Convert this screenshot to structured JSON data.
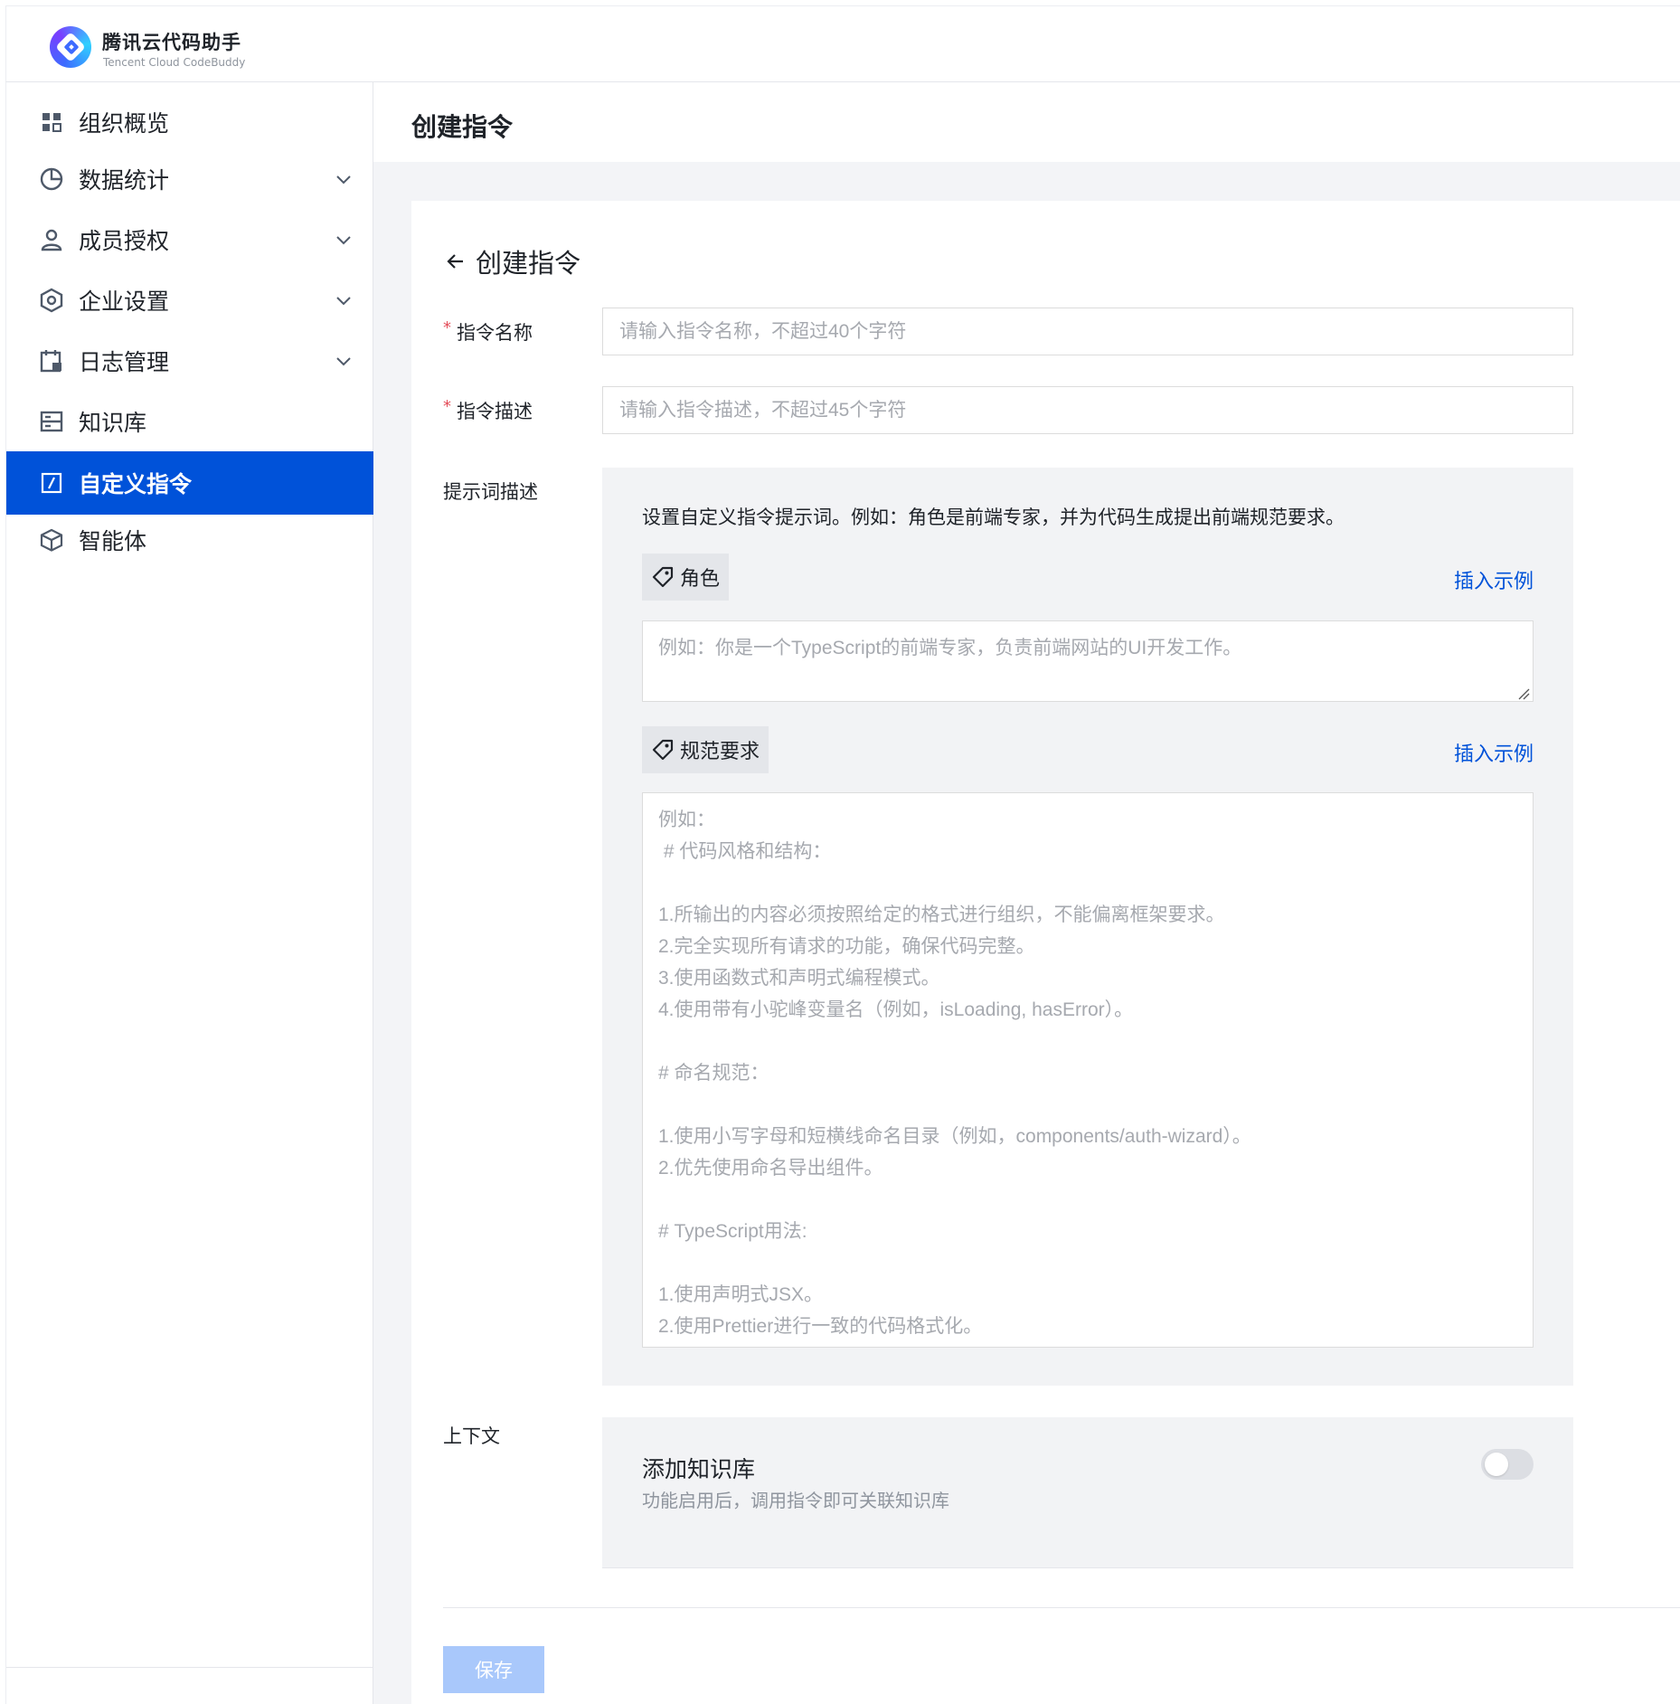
{
  "brand": {
    "title": "腾讯云代码助手",
    "subtitle": "Tencent Cloud CodeBuddy"
  },
  "sidebar": {
    "items": [
      {
        "label": "组织概览",
        "icon": "grid-icon",
        "has_chevron": false,
        "active": false
      },
      {
        "label": "数据统计",
        "icon": "pie-chart-icon",
        "has_chevron": true,
        "active": false
      },
      {
        "label": "成员授权",
        "icon": "user-icon",
        "has_chevron": true,
        "active": false
      },
      {
        "label": "企业设置",
        "icon": "settings-icon",
        "has_chevron": true,
        "active": false
      },
      {
        "label": "日志管理",
        "icon": "calendar-log-icon",
        "has_chevron": true,
        "active": false
      },
      {
        "label": "知识库",
        "icon": "database-icon",
        "has_chevron": false,
        "active": false
      },
      {
        "label": "自定义指令",
        "icon": "slash-command-icon",
        "has_chevron": false,
        "active": true
      },
      {
        "label": "智能体",
        "icon": "cube-icon",
        "has_chevron": false,
        "active": false
      }
    ]
  },
  "page": {
    "title": "创建指令",
    "back_label": "创建指令"
  },
  "form": {
    "name": {
      "label": "指令名称",
      "required_mark": "*",
      "value": "",
      "placeholder": "请输入指令名称，不超过40个字符"
    },
    "desc": {
      "label": "指令描述",
      "required_mark": "*",
      "value": "",
      "placeholder": "请输入指令描述，不超过45个字符"
    },
    "prompt": {
      "label": "提示词描述",
      "intro": "设置自定义指令提示词。例如：角色是前端专家，并为代码生成提出前端规范要求。",
      "role": {
        "tag": "角色",
        "insert_label": "插入示例",
        "value": "",
        "placeholder": "例如：你是一个TypeScript的前端专家，负责前端网站的UI开发工作。"
      },
      "rules": {
        "tag": "规范要求",
        "insert_label": "插入示例",
        "value": "",
        "placeholder": "例如：\n # 代码风格和结构：\n\n1.所输出的内容必须按照给定的格式进行组织，不能偏离框架要求。\n2.完全实现所有请求的功能，确保代码完整。\n3.使用函数式和声明式编程模式。\n4.使用带有小驼峰变量名（例如，isLoading, hasError）。\n\n# 命名规范：\n\n1.使用小写字母和短横线命名目录（例如，components/auth-wizard）。\n2.优先使用命名导出组件。\n\n# TypeScript用法:\n\n1.使用声明式JSX。\n2.使用Prettier进行一致的代码格式化。"
      }
    },
    "context": {
      "label": "上下文",
      "kb_title": "添加知识库",
      "kb_desc": "功能启用后，调用指令即可关联知识库",
      "kb_enabled": false
    },
    "save_label": "保存"
  },
  "colors": {
    "primary": "#0052d9",
    "save_disabled": "#a9c8fb",
    "required": "#e34d59"
  }
}
